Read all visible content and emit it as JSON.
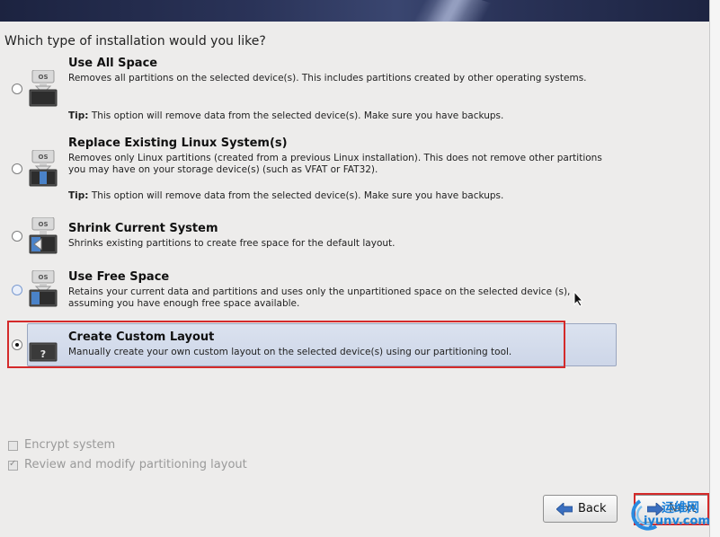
{
  "question": "Which type of installation would you like?",
  "options": [
    {
      "title": "Use All Space",
      "description": "Removes all partitions on the selected device(s).  This includes partitions created by other operating systems.",
      "tip_label": "Tip:",
      "tip_text": " This option will remove data from the selected device(s).  Make sure you have backups.",
      "icon": "disk-os-icon",
      "icon_label": "OS",
      "selected": false
    },
    {
      "title": "Replace Existing Linux System(s)",
      "description": "Removes only Linux partitions (created from a previous Linux installation).  This does not remove other partitions you may have on your storage device(s) (such as VFAT or FAT32).",
      "tip_label": "Tip:",
      "tip_text": " This option will remove data from the selected device(s).  Make sure you have backups.",
      "icon": "disk-os-icon",
      "icon_label": "OS",
      "selected": false
    },
    {
      "title": "Shrink Current System",
      "description": "Shrinks existing partitions to create free space for the default layout.",
      "icon": "disk-shrink-icon",
      "icon_label": "OS",
      "selected": false
    },
    {
      "title": "Use Free Space",
      "description": "Retains your current data and partitions and uses only the unpartitioned space on the selected device (s), assuming you have enough free space available.",
      "icon": "disk-free-icon",
      "icon_label": "OS",
      "selected": false
    },
    {
      "title": "Create Custom Layout",
      "description": "Manually create your own custom layout on the selected device(s) using our partitioning tool.",
      "icon": "disk-question-icon",
      "icon_label": "?",
      "selected": true
    }
  ],
  "checkboxes": [
    {
      "label": "Encrypt system",
      "checked": false,
      "enabled": false
    },
    {
      "label": "Review and modify partitioning layout",
      "checked": true,
      "enabled": false
    }
  ],
  "buttons": {
    "back": "Back",
    "next": "Next"
  },
  "watermark": {
    "text": "iyunv.com",
    "cn": "运维网"
  },
  "colors": {
    "banner": "#1c2340",
    "highlight": "#cdd6e8",
    "annotation": "#d42a2a",
    "watermark": "#1a7fd8"
  }
}
